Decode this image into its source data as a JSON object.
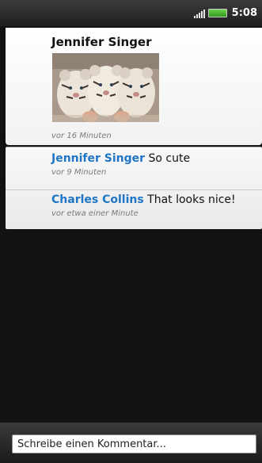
{
  "status_bar": {
    "time": "5:08",
    "signal_icon": "signal-bars-icon",
    "battery_icon": "battery-icon"
  },
  "post": {
    "author": "Jennifer Singer",
    "photo_description": "photo-thumbnail",
    "time_ago": "vor 16 Minuten"
  },
  "comments": [
    {
      "author": "Jennifer Singer",
      "text": "So cute",
      "time_ago": "vor 9 Minuten"
    },
    {
      "author": "Charles Collins",
      "text": "That looks nice!",
      "time_ago": "vor etwa einer Minute"
    }
  ],
  "comment_input": {
    "placeholder": "Schreibe einen Kommentar..."
  },
  "colors": {
    "author_link": "#1f75c6",
    "background": "#121212",
    "battery": "#4fbf2f"
  }
}
